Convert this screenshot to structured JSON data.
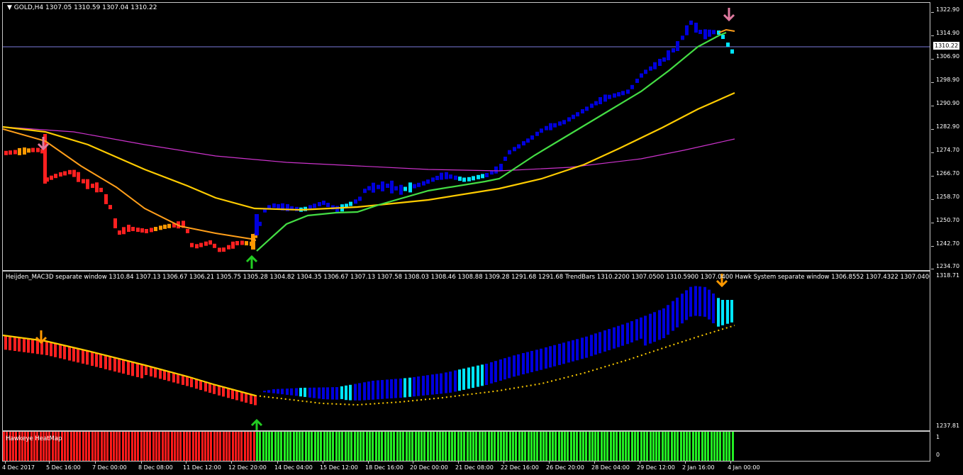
{
  "symbol_header": "GOLD,H4  1307.05 1310.59 1307.04 1310.22",
  "current_price": "1310.22",
  "price_axis": [
    "1322.90",
    "1314.90",
    "1306.90",
    "1298.90",
    "1290.90",
    "1282.90",
    "1274.70",
    "1266.70",
    "1258.70",
    "1250.70",
    "1242.70",
    "1234.70"
  ],
  "mac_label": "Heijden_MAC3D separate window 1310.84 1307.13 1306.67 1306.21 1305.75 1305.28 1304.82 1304.35 1306.67 1307.13 1307.58 1308.03 1308.46 1308.88 1309.28 1291.68 1291.68  TrendBars 1310.2200 1307.0500 1310.5900 1307.0400  Hawk System separate window 1306.8552 1307.4322 1307.0400 1310.5900",
  "mac_axis": [
    "1318.71",
    "1237.81"
  ],
  "heatmap_label": "Hawkeye HeatMap",
  "heatmap_axis": [
    "1",
    "0"
  ],
  "date_axis": [
    "4 Dec 2017",
    "5 Dec 16:00",
    "7 Dec 00:00",
    "8 Dec 08:00",
    "11 Dec 12:00",
    "12 Dec 20:00",
    "14 Dec 04:00",
    "15 Dec 12:00",
    "18 Dec 16:00",
    "20 Dec 00:00",
    "21 Dec 08:00",
    "22 Dec 16:00",
    "26 Dec 20:00",
    "28 Dec 04:00",
    "29 Dec 12:00",
    "2 Jan 16:00",
    "4 Jan 00:00"
  ],
  "colors": {
    "bear_bar": "#ff2020",
    "bull_bar": "#0000dd",
    "weak_bull_bar": "#00e5ff",
    "neutral_bar": "#ff9900",
    "ma_fast": "#ff9f1a",
    "ma_mid": "#ffcc00",
    "ma_green": "#44dd44",
    "ma_slow": "#cc33cc",
    "price_line": "#7b7bdb",
    "heat_red": "#ff1a1a",
    "heat_green": "#22ee22",
    "arrow_sell": "#e07aa0",
    "arrow_buy": "#22cc22",
    "arrow_orange": "#ff9900"
  },
  "icons": [
    "sell-arrow-icon",
    "buy-arrow-icon",
    "dropdown-triangle-icon"
  ]
}
